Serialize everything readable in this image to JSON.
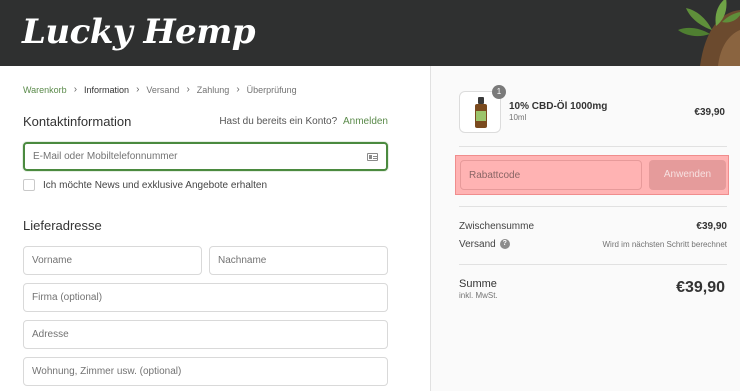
{
  "header": {
    "brand": "Lucky Hemp"
  },
  "breadcrumb": {
    "items": [
      {
        "label": "Warenkorb"
      },
      {
        "label": "Information"
      },
      {
        "label": "Versand"
      },
      {
        "label": "Zahlung"
      },
      {
        "label": "Überprüfung"
      }
    ]
  },
  "contact": {
    "title": "Kontaktinformation",
    "account_prompt": "Hast du bereits ein Konto?",
    "login_link": "Anmelden",
    "email_placeholder": "E-Mail oder Mobiltelefonnummer",
    "newsletter_label": "Ich möchte News und exklusive Angebote erhalten"
  },
  "shipping": {
    "title": "Lieferadresse",
    "first_name_placeholder": "Vorname",
    "last_name_placeholder": "Nachname",
    "company_placeholder": "Firma (optional)",
    "address_placeholder": "Adresse",
    "apartment_placeholder": "Wohnung, Zimmer usw. (optional)"
  },
  "order": {
    "item": {
      "quantity": "1",
      "name": "10% CBD-Öl 1000mg",
      "variant": "10ml",
      "price": "€39,90"
    },
    "discount": {
      "placeholder": "Rabattcode",
      "apply_label": "Anwenden"
    },
    "subtotal_label": "Zwischensumme",
    "subtotal_value": "€39,90",
    "shipping_label": "Versand",
    "shipping_value": "Wird im nächsten Schritt berechnet",
    "total_label": "Summe",
    "total_sub": "inkl. MwSt.",
    "total_value": "€39,90"
  },
  "colors": {
    "header_bg": "#2f3030",
    "accent_green": "#4b8a3f",
    "highlight_red": "#ffb3b3"
  }
}
